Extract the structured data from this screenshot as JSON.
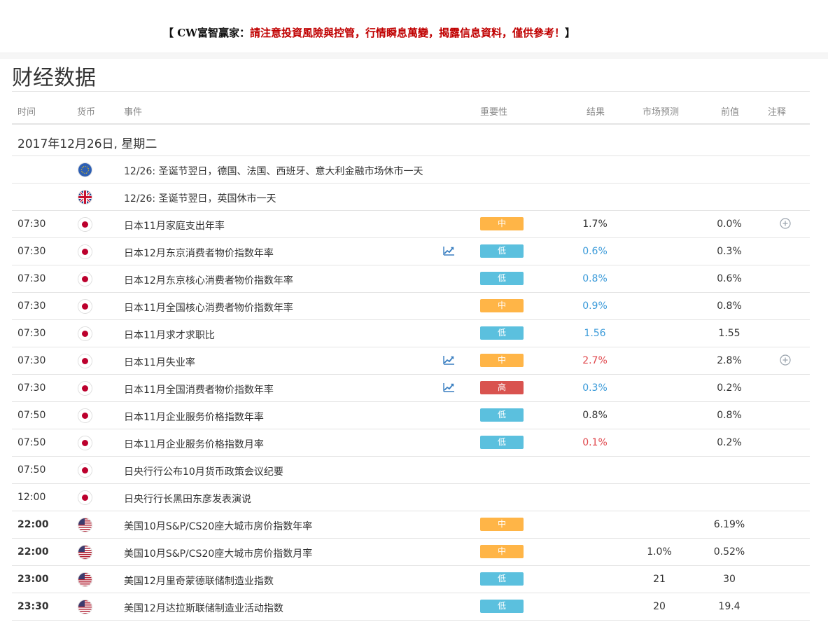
{
  "banner": {
    "left": "【 CW富智赢家：",
    "right": "請注意投資風險與控管，行情瞬息萬變，揭露信息資料，僅供參考！",
    "close": "】"
  },
  "title": "财经数据",
  "headers": {
    "time": "时间",
    "currency": "货币",
    "event": "事件",
    "importance": "重要性",
    "result": "结果",
    "forecast": "市场预测",
    "previous": "前值",
    "note": "注释"
  },
  "date": "2017年12月26日, 星期二",
  "rows": [
    {
      "time": "",
      "bold": false,
      "flag": "eu-flag-icon",
      "event": "12/26: 圣诞节翌日，德国、法国、西班牙、意大利金融市场休市一天",
      "chart": false,
      "importance": "",
      "imp_level": "",
      "result": "",
      "result_tone": "neutral",
      "forecast": "",
      "previous": "",
      "note": false
    },
    {
      "time": "",
      "bold": false,
      "flag": "uk-flag-icon",
      "event": "12/26: 圣诞节翌日，英国休市一天",
      "chart": false,
      "importance": "",
      "imp_level": "",
      "result": "",
      "result_tone": "neutral",
      "forecast": "",
      "previous": "",
      "note": false
    },
    {
      "time": "07:30",
      "bold": false,
      "flag": "jp-flag-icon",
      "event": "日本11月家庭支出年率",
      "chart": false,
      "importance": "中",
      "imp_level": "mid",
      "result": "1.7%",
      "result_tone": "neutral",
      "forecast": "",
      "previous": "0.0%",
      "note": true
    },
    {
      "time": "07:30",
      "bold": false,
      "flag": "jp-flag-icon",
      "event": "日本12月东京消费者物价指数年率",
      "chart": true,
      "importance": "低",
      "imp_level": "low",
      "result": "0.6%",
      "result_tone": "good",
      "forecast": "",
      "previous": "0.3%",
      "note": false
    },
    {
      "time": "07:30",
      "bold": false,
      "flag": "jp-flag-icon",
      "event": "日本12月东京核心消费者物价指数年率",
      "chart": false,
      "importance": "低",
      "imp_level": "low",
      "result": "0.8%",
      "result_tone": "good",
      "forecast": "",
      "previous": "0.6%",
      "note": false
    },
    {
      "time": "07:30",
      "bold": false,
      "flag": "jp-flag-icon",
      "event": "日本11月全国核心消费者物价指数年率",
      "chart": false,
      "importance": "中",
      "imp_level": "mid",
      "result": "0.9%",
      "result_tone": "good",
      "forecast": "",
      "previous": "0.8%",
      "note": false
    },
    {
      "time": "07:30",
      "bold": false,
      "flag": "jp-flag-icon",
      "event": "日本11月求才求职比",
      "chart": false,
      "importance": "低",
      "imp_level": "low",
      "result": "1.56",
      "result_tone": "good",
      "forecast": "",
      "previous": "1.55",
      "note": false
    },
    {
      "time": "07:30",
      "bold": false,
      "flag": "jp-flag-icon",
      "event": "日本11月失业率",
      "chart": true,
      "importance": "中",
      "imp_level": "mid",
      "result": "2.7%",
      "result_tone": "bad",
      "forecast": "",
      "previous": "2.8%",
      "note": true
    },
    {
      "time": "07:30",
      "bold": false,
      "flag": "jp-flag-icon",
      "event": "日本11月全国消费者物价指数年率",
      "chart": true,
      "importance": "高",
      "imp_level": "high",
      "result": "0.3%",
      "result_tone": "good",
      "forecast": "",
      "previous": "0.2%",
      "note": false
    },
    {
      "time": "07:50",
      "bold": false,
      "flag": "jp-flag-icon",
      "event": "日本11月企业服务价格指数年率",
      "chart": false,
      "importance": "低",
      "imp_level": "low",
      "result": "0.8%",
      "result_tone": "neutral",
      "forecast": "",
      "previous": "0.8%",
      "note": false
    },
    {
      "time": "07:50",
      "bold": false,
      "flag": "jp-flag-icon",
      "event": "日本11月企业服务价格指数月率",
      "chart": false,
      "importance": "低",
      "imp_level": "low",
      "result": "0.1%",
      "result_tone": "bad",
      "forecast": "",
      "previous": "0.2%",
      "note": false
    },
    {
      "time": "07:50",
      "bold": false,
      "flag": "jp-flag-icon",
      "event": "日央行行公布10月货币政策会议纪要",
      "chart": false,
      "importance": "",
      "imp_level": "",
      "result": "",
      "result_tone": "neutral",
      "forecast": "",
      "previous": "",
      "note": false
    },
    {
      "time": "12:00",
      "bold": false,
      "flag": "jp-flag-icon",
      "event": "日央行行长黑田东彦发表演说",
      "chart": false,
      "importance": "",
      "imp_level": "",
      "result": "",
      "result_tone": "neutral",
      "forecast": "",
      "previous": "",
      "note": false
    },
    {
      "time": "22:00",
      "bold": true,
      "flag": "us-flag-icon",
      "event": "美国10月S&P/CS20座大城市房价指数年率",
      "chart": false,
      "importance": "中",
      "imp_level": "mid",
      "result": "",
      "result_tone": "neutral",
      "forecast": "",
      "previous": "6.19%",
      "note": false
    },
    {
      "time": "22:00",
      "bold": true,
      "flag": "us-flag-icon",
      "event": "美国10月S&P/CS20座大城市房价指数月率",
      "chart": false,
      "importance": "中",
      "imp_level": "mid",
      "result": "",
      "result_tone": "neutral",
      "forecast": "1.0%",
      "previous": "0.52%",
      "note": false
    },
    {
      "time": "23:00",
      "bold": true,
      "flag": "us-flag-icon",
      "event": "美国12月里奇蒙德联储制造业指数",
      "chart": false,
      "importance": "低",
      "imp_level": "low",
      "result": "",
      "result_tone": "neutral",
      "forecast": "21",
      "previous": "30",
      "note": false
    },
    {
      "time": "23:30",
      "bold": true,
      "flag": "us-flag-icon",
      "event": "美国12月达拉斯联储制造业活动指数",
      "chart": false,
      "importance": "低",
      "imp_level": "low",
      "result": "",
      "result_tone": "neutral",
      "forecast": "20",
      "previous": "19.4",
      "note": false
    }
  ]
}
